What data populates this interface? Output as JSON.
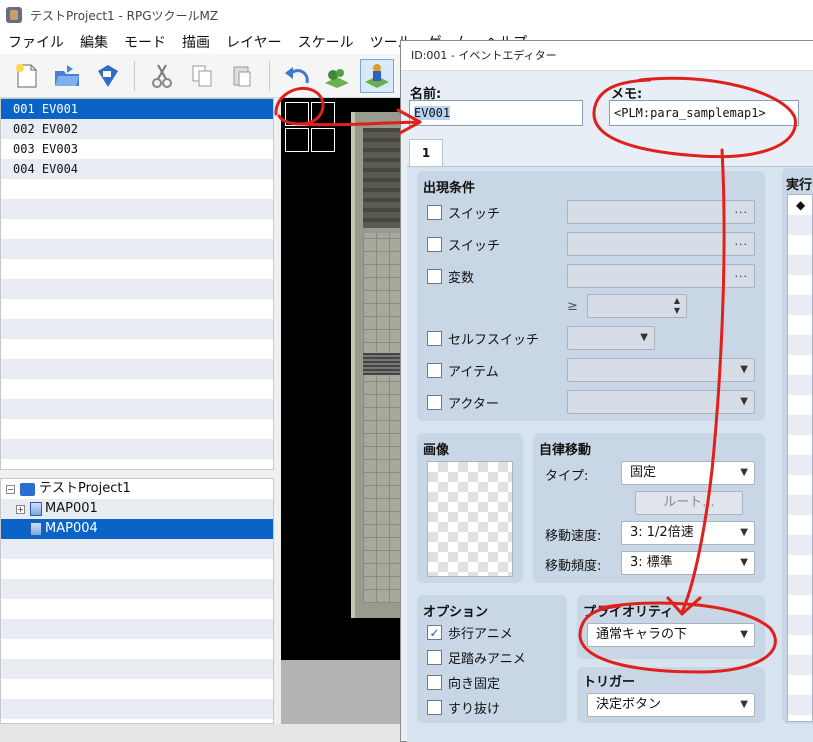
{
  "window": {
    "title": "テストProject1 - RPGツクールMZ"
  },
  "menu": [
    "ファイル",
    "編集",
    "モード",
    "描画",
    "レイヤー",
    "スケール",
    "ツール",
    "ゲーム",
    "ヘルプ"
  ],
  "toolbar": {
    "icons": [
      "new-project-icon",
      "open-project-icon",
      "save-project-icon",
      "cut-icon",
      "copy-icon",
      "paste-icon",
      "undo-icon",
      "map-mode-icon",
      "event-mode-icon"
    ],
    "active": "event-mode-icon"
  },
  "events": [
    {
      "label": "001  EV001",
      "selected": true
    },
    {
      "label": "002  EV002"
    },
    {
      "label": "003  EV003"
    },
    {
      "label": "004  EV004"
    }
  ],
  "map_tree": {
    "project": "テストProject1",
    "maps": [
      {
        "label": "MAP001",
        "has_children": true
      },
      {
        "label": "MAP004",
        "selected": true
      }
    ]
  },
  "dialog": {
    "title": "ID:001 - イベントエディター",
    "name_label": "名前:",
    "name_value": "EV001",
    "memo_label": "メモ:",
    "memo_value": "<PLM:para_samplemap1>",
    "tab": "1",
    "conditions": {
      "title": "出現条件",
      "switch1": "スイッチ",
      "switch2": "スイッチ",
      "variable": "変数",
      "gte": "≥",
      "self_switch": "セルフスイッチ",
      "item": "アイテム",
      "actor": "アクター",
      "dots": "..."
    },
    "image": {
      "title": "画像"
    },
    "autonomous": {
      "title": "自律移動",
      "type_label": "タイプ:",
      "type_value": "固定",
      "route_button": "ルート...",
      "speed_label": "移動速度:",
      "speed_value": "3: 1/2倍速",
      "freq_label": "移動頻度:",
      "freq_value": "3: 標準"
    },
    "options": {
      "title": "オプション",
      "walking": "歩行アニメ",
      "stepping": "足踏みアニメ",
      "dir_fix": "向き固定",
      "through": "すり抜け",
      "walking_checked": true
    },
    "priority": {
      "title": "プライオリティ",
      "value": "通常キャラの下"
    },
    "trigger": {
      "title": "トリガー",
      "value": "決定ボタン"
    },
    "contents": {
      "title": "実行内",
      "first_item": "◆"
    }
  },
  "annotation": {
    "color": "#e0201a"
  }
}
